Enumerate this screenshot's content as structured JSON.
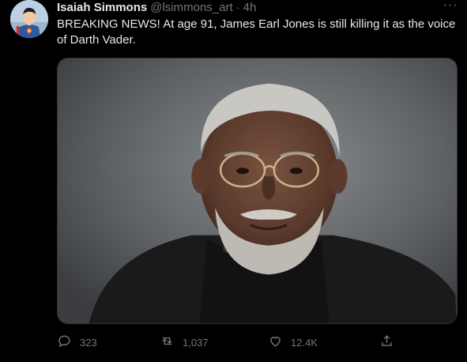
{
  "tweet": {
    "author_name": "Isaiah Simmons",
    "handle": "@lsimmons_art",
    "separator": "·",
    "time": "4h",
    "more_label": "···",
    "text": "BREAKING NEWS! At age 91, James Earl Jones is still killing it as the voice of Darth Vader."
  },
  "actions": {
    "replies": "323",
    "retweets": "1,037",
    "likes": "12.4K"
  },
  "icons": {
    "reply": "comment-icon",
    "retweet": "retweet-icon",
    "like": "heart-icon",
    "share": "share-icon"
  },
  "colors": {
    "background": "#000000",
    "text": "#e7e9ea",
    "muted": "#71767b",
    "border": "#2f3336"
  }
}
